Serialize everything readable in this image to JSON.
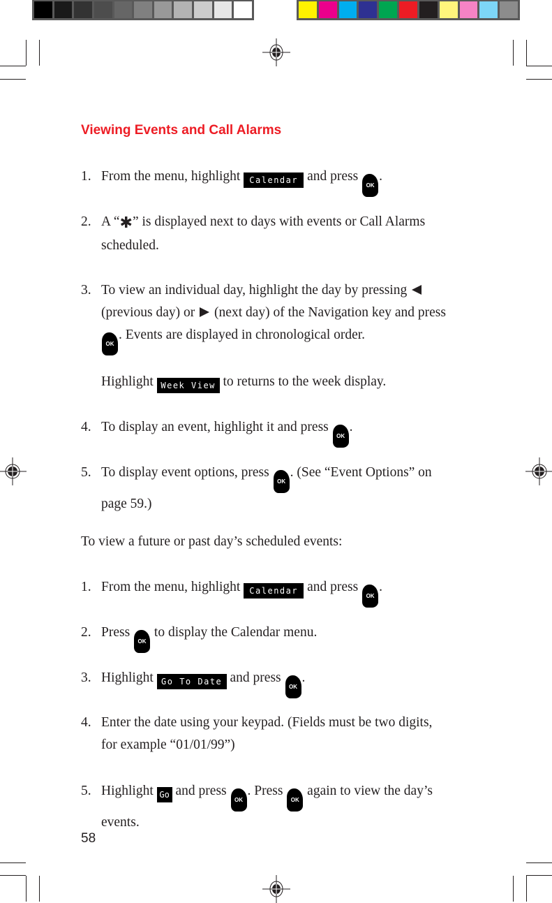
{
  "print_marks": {
    "grayscale_swatches": [
      "#000000",
      "#1a1a1a",
      "#333333",
      "#4d4d4d",
      "#666666",
      "#808080",
      "#999999",
      "#b3b3b3",
      "#cccccc",
      "#e6e6e6",
      "#ffffff"
    ],
    "color_swatches": [
      "#fff200",
      "#ec008c",
      "#00aeef",
      "#2e3192",
      "#00a651",
      "#ed1c24",
      "#231f20",
      "#fff57c",
      "#f683c5",
      "#7dd6f7",
      "#8c8c8c"
    ]
  },
  "heading": {
    "title": "Viewing Events and Call Alarms",
    "color": "#ed1c24"
  },
  "lcd_labels": {
    "calendar": "Calendar",
    "week_view": "Week View",
    "go_to_date": "Go To Date",
    "go": "Go"
  },
  "keys": {
    "ok": "OK"
  },
  "section1": {
    "items": [
      {
        "num": "1.",
        "before": "From the menu, highlight ",
        "middle": " and press ",
        "after": "."
      },
      {
        "num": "2.",
        "before": "A “",
        "after": "” is displayed next to days with events or Call Alarms",
        "line2": "scheduled."
      },
      {
        "num": "3.",
        "line1": "To view an individual day, highlight the day by pressing ",
        "line2a": "(previous day) or ",
        "line2b": " (next day) of the Navigation key and press",
        "line3": ". Events are displayed in chronological order."
      },
      {
        "before": "Highlight ",
        "after": " to returns to the week display."
      },
      {
        "num": "4.",
        "before": "To display an event, highlight it and press ",
        "after": "."
      },
      {
        "num": "5.",
        "before": "To display event options, press ",
        "after": ". (See “Event Options” on",
        "line2": "page 59.)"
      }
    ]
  },
  "section2": {
    "intro": "To view a future or past day’s scheduled events:",
    "items": [
      {
        "num": "1.",
        "before": "From the menu, highlight ",
        "middle": " and press ",
        "after": "."
      },
      {
        "num": "2.",
        "before": "Press ",
        "after": " to display the Calendar menu."
      },
      {
        "num": "3.",
        "before": "Highlight ",
        "middle": " and press ",
        "after": "."
      },
      {
        "num": "4.",
        "line1": "Enter the date using your keypad. (Fields must be two digits,",
        "line2": "for example “01/01/99”)"
      },
      {
        "num": "5.",
        "before": "Highlight ",
        "middle1": " and press ",
        "middle2": ". Press ",
        "after": " again to view the day’s",
        "line2": "events."
      }
    ]
  },
  "page_number": "58"
}
